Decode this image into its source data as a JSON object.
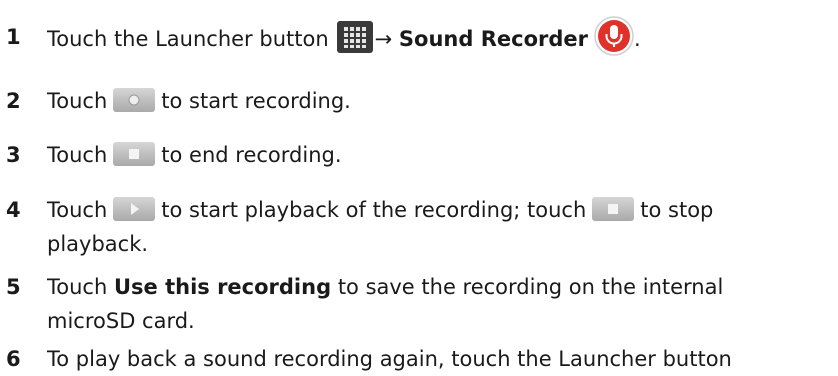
{
  "steps": [
    {
      "num": "1",
      "t1": "Touch the Launcher button",
      "arrow": "→",
      "bold": "Sound Recorder",
      "t2": ".",
      "icons": [
        "launcher-grid-icon",
        "sound-recorder-mic-icon"
      ]
    },
    {
      "num": "2",
      "t1": "Touch",
      "t2": "to start recording.",
      "icons": [
        "record-button-icon"
      ]
    },
    {
      "num": "3",
      "t1": "Touch",
      "t2": "to end recording.",
      "icons": [
        "stop-button-icon"
      ]
    },
    {
      "num": "4",
      "t1": "Touch",
      "t2": "to start playback of the recording; touch",
      "t3": "to stop",
      "t4": "playback.",
      "icons": [
        "play-button-icon",
        "stop-button-icon"
      ]
    },
    {
      "num": "5",
      "t1": "Touch",
      "bold": "Use this recording",
      "t2": "to save the recording on the internal",
      "t3": "microSD card."
    },
    {
      "num": "6",
      "t1": "To play back a sound recording again, touch the Launcher button"
    }
  ],
  "colors": {
    "text": "#1a1a1a",
    "mic_red": "#e0312a",
    "button_gray": "#b5b5b5",
    "launcher_dark": "#3a3a3a"
  }
}
